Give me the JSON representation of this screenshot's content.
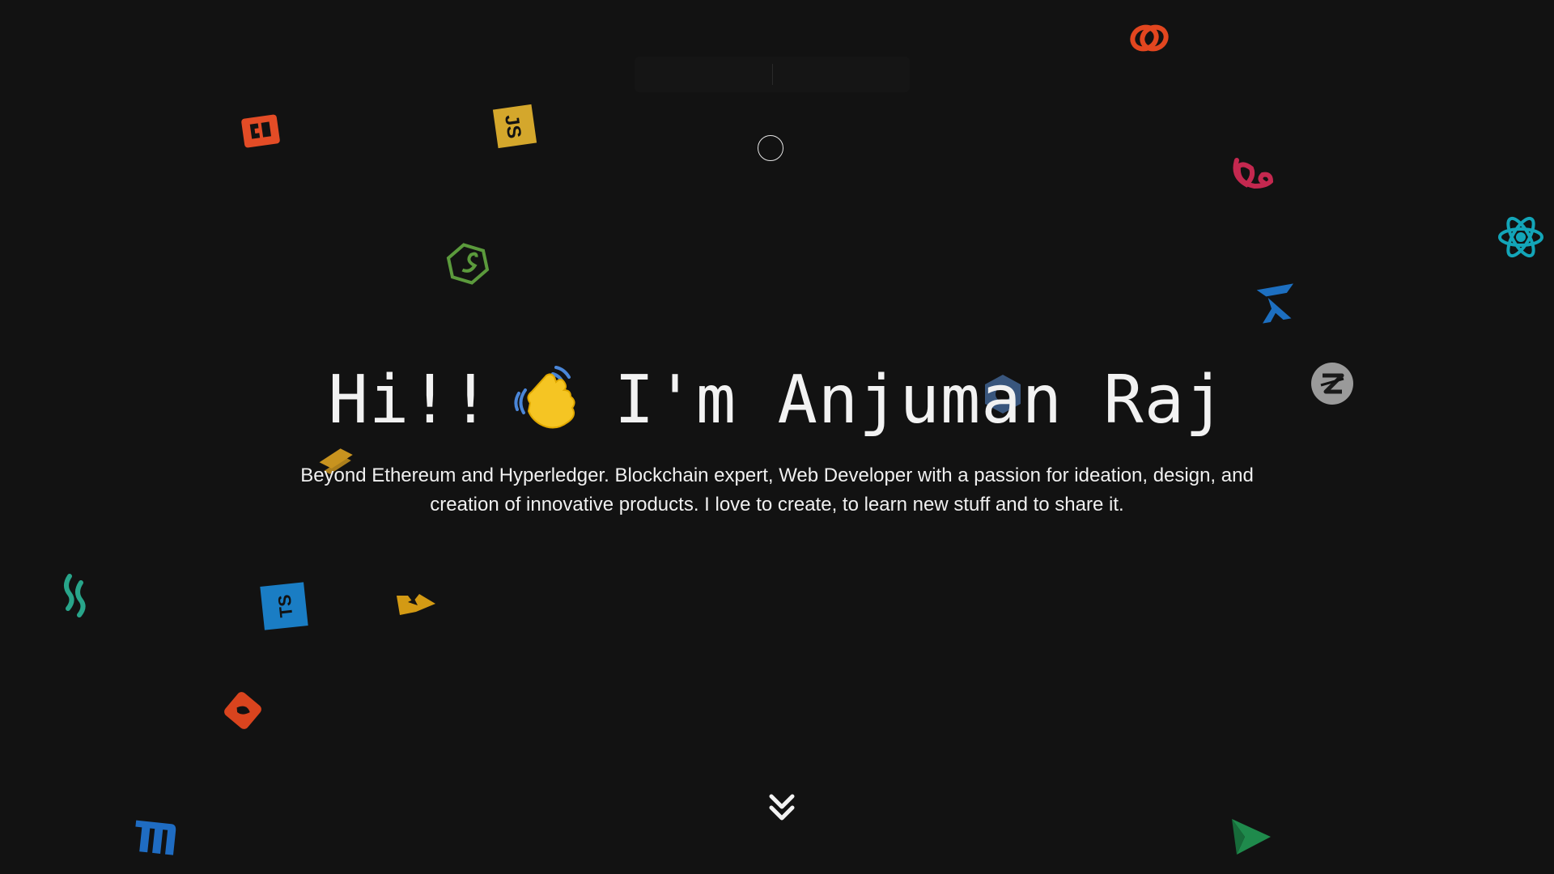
{
  "hero": {
    "title_greeting": "Hi!!",
    "title_name": "I'm Anjuman Raj",
    "subtitle": "Beyond Ethereum and Hyperledger. Blockchain expert, Web Developer with a passion for ideation, design, and creation of innovative products. I love to create, to learn new stuff and to share it."
  },
  "icons": [
    "html5-icon",
    "javascript-icon",
    "nodejs-icon",
    "chainlink-icon",
    "vue-icon",
    "react-icon",
    "framer-icon",
    "zend-icon",
    "ipfs-icon",
    "typescript-icon",
    "heroku-icon",
    "spring-icon",
    "codeigniter-icon",
    "mariadb-icon",
    "vercel-icon",
    "firebase-icon",
    "waving-hand-icon",
    "scroll-down-icon"
  ],
  "colors": {
    "background": "#121212",
    "text": "#f2f2f2"
  }
}
